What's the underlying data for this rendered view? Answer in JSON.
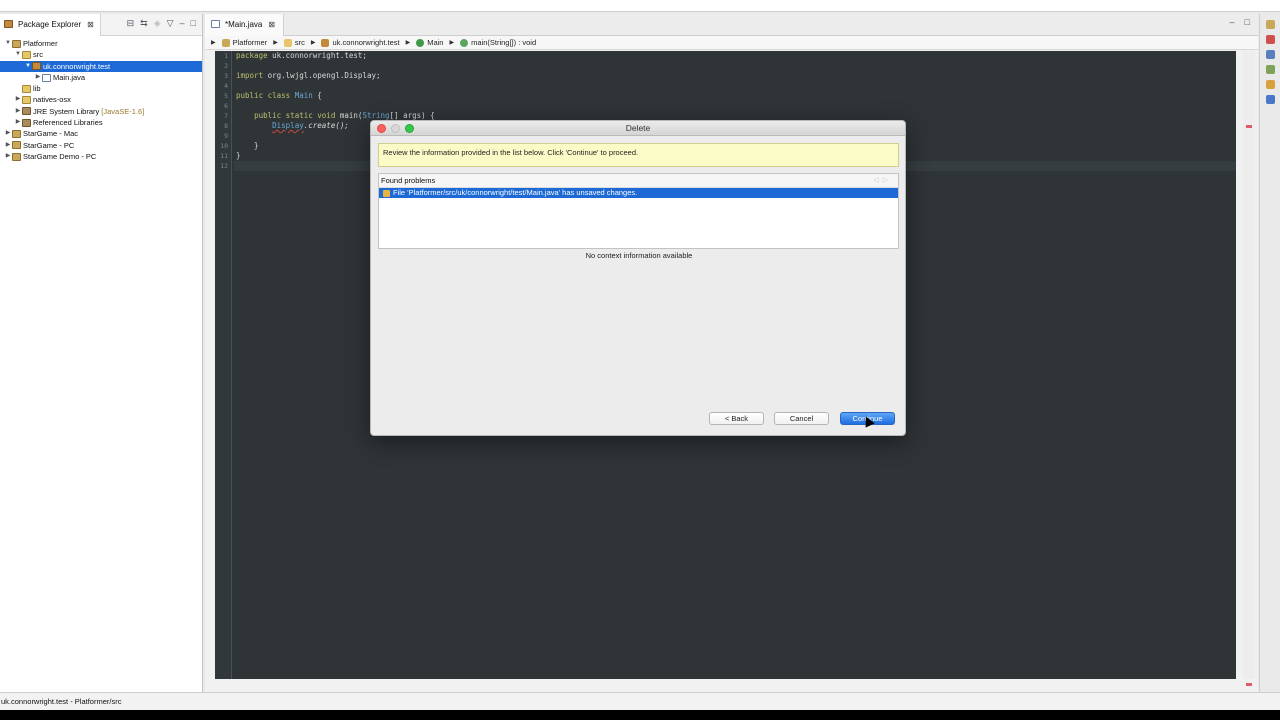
{
  "explorer": {
    "tab_title": "Package Explorer",
    "tree": [
      {
        "label": "Platformer",
        "twisty": "▼",
        "icon": "project-icon",
        "indent": 0
      },
      {
        "label": "src",
        "twisty": "▼",
        "icon": "folder-icon",
        "indent": 1
      },
      {
        "label": "uk.connorwright.test",
        "twisty": "▼",
        "icon": "package-icon",
        "indent": 2,
        "selected": true
      },
      {
        "label": "Main.java",
        "twisty": "▶",
        "icon": "java-file-icon",
        "indent": 3
      },
      {
        "label": "lib",
        "twisty": "",
        "icon": "folder-icon",
        "indent": 1
      },
      {
        "label": "natives-osx",
        "twisty": "▶",
        "icon": "folder-icon",
        "indent": 1
      },
      {
        "label": "JRE System Library",
        "twisty": "▶",
        "icon": "library-icon",
        "indent": 1,
        "tag": "[JavaSE-1.6]"
      },
      {
        "label": "Referenced Libraries",
        "twisty": "▶",
        "icon": "library-icon",
        "indent": 1
      },
      {
        "label": "StarGame - Mac",
        "twisty": "▶",
        "icon": "project-icon",
        "indent": 0
      },
      {
        "label": "StarGame - PC",
        "twisty": "▶",
        "icon": "project-icon",
        "indent": 0
      },
      {
        "label": "StarGame Demo - PC",
        "twisty": "▶",
        "icon": "project-icon",
        "indent": 0
      }
    ]
  },
  "editor": {
    "tab_title": "*Main.java",
    "breadcrumb": [
      "Platformer",
      "src",
      "uk.connorwright.test",
      "Main",
      "main(String[]) : void"
    ],
    "line_numbers": [
      "1",
      "2",
      "3",
      "4",
      "5",
      "6",
      "7",
      "8",
      "9",
      "10",
      "11",
      "12"
    ],
    "code": {
      "l1_kw": "package",
      "l1_rest": " uk.connorwright.test;",
      "l3_kw": "import",
      "l3_rest": " org.lwjgl.opengl.Display;",
      "l5_kw": "public class",
      "l5_cls": " Main",
      "l5_rest": " {",
      "l7_indent": "    ",
      "l7_kw": "public static void",
      "l7_a": " main(",
      "l7_cls": "String",
      "l7_b": "[] args) {",
      "l8_indent": "        ",
      "l8_cls": "Display",
      "l8_rest": ".create();",
      "l10": "    }",
      "l11": "}"
    }
  },
  "dialog": {
    "title": "Delete",
    "message": "Review the information provided in the list below. Click 'Continue' to proceed.",
    "problems_header": "Found problems",
    "problem": "File 'Platformer/src/uk/connorwright/test/Main.java' has unsaved changes.",
    "no_context": "No context information available",
    "back_label": "< Back",
    "cancel_label": "Cancel",
    "continue_label": "Continue"
  },
  "status": {
    "text": "uk.connorwright.test - Platformer/src"
  },
  "colors": {
    "selection": "#1d69d6",
    "editor_bg": "#2f3437",
    "message_bg": "#fbfbc8",
    "primary_button": "#1f6fe0"
  }
}
